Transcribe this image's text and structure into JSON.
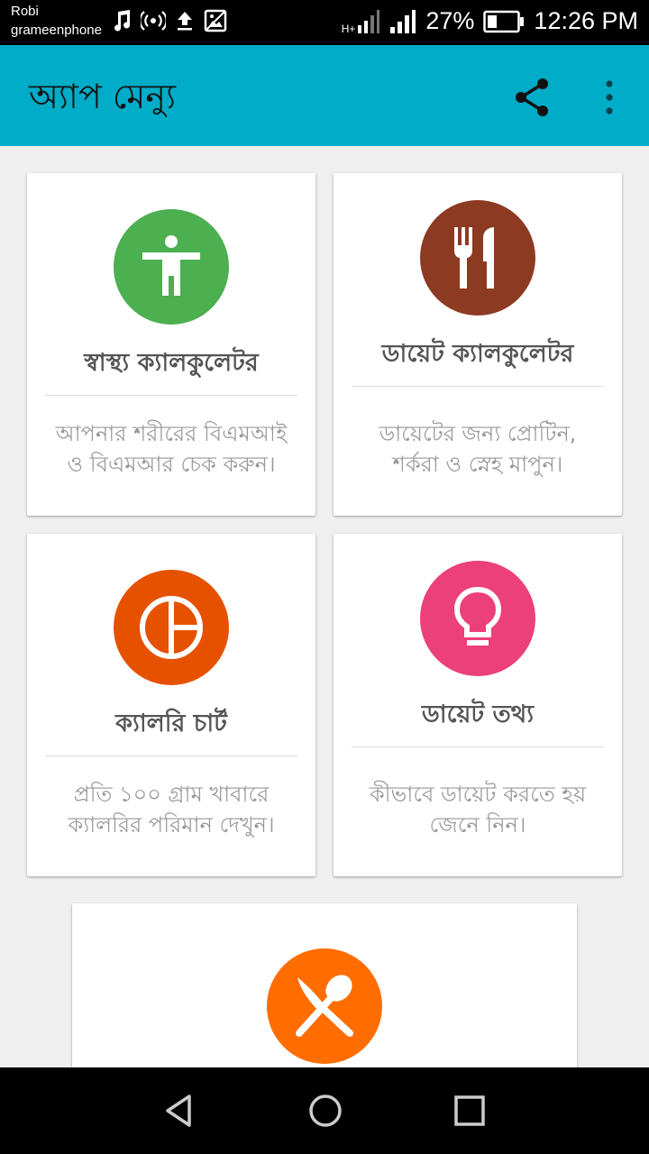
{
  "status_bar": {
    "carrier_line1": "Robi",
    "carrier_line2": "grameenphone",
    "net_type": "H+",
    "battery": "27%",
    "time": "12:26 PM"
  },
  "app_bar": {
    "title": "অ্যাপ মেন্যু",
    "color": "#00acc7"
  },
  "cards": [
    {
      "title": "স্বাস্থ্য ক্যালকুলেটর",
      "desc_line1": "আপনার শরীরের বিএমআই",
      "desc_line2": "ও বিএমআর চেক করুন।",
      "icon": "accessibility-icon",
      "color": "#4caf50"
    },
    {
      "title": "ডায়েট ক্যালকুলেটর",
      "desc_line1": "ডায়েটের জন্য প্রোটিন,",
      "desc_line2": "শর্করা ও স্নেহ মাপুন।",
      "icon": "fork-knife-icon",
      "color": "#8d3a22"
    },
    {
      "title": "ক্যালরি চার্ট",
      "desc_line1": "প্রতি ১০০ গ্রাম খাবারে",
      "desc_line2": "ক্যালরির পরিমান দেখুন।",
      "icon": "pie-chart-icon",
      "color": "#e65100"
    },
    {
      "title": "ডায়েট তথ্য",
      "desc_line1": "কীভাবে ডায়েট করতে হয়",
      "desc_line2": "জেনে নিন।",
      "icon": "lightbulb-icon",
      "color": "#ec407a"
    },
    {
      "icon": "spoon-knife-icon",
      "color": "#ff6d00"
    }
  ]
}
